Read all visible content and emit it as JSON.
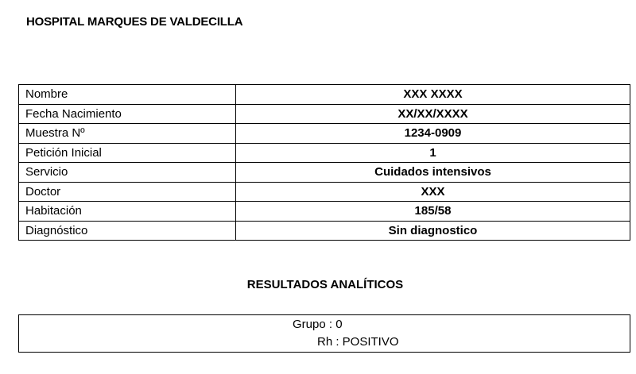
{
  "header": {
    "title": "HOSPITAL MARQUES DE VALDECILLA"
  },
  "patient_info": {
    "rows": [
      {
        "label": "Nombre",
        "value": "XXX XXXX"
      },
      {
        "label": "Fecha Nacimiento",
        "value": "XX/XX/XXXX"
      },
      {
        "label": "Muestra Nº",
        "value": "1234-0909"
      },
      {
        "label": "Petición Inicial",
        "value": "1"
      },
      {
        "label": "Servicio",
        "value": "Cuidados intensivos"
      },
      {
        "label": "Doctor",
        "value": "XXX"
      },
      {
        "label": "Habitación",
        "value": "185/58"
      },
      {
        "label": "Diagnóstico",
        "value": "Sin diagnostico"
      }
    ]
  },
  "results": {
    "title": "RESULTADOS ANALÍTICOS",
    "group_line": "Grupo : 0",
    "rh_line": "Rh : POSITIVO"
  }
}
